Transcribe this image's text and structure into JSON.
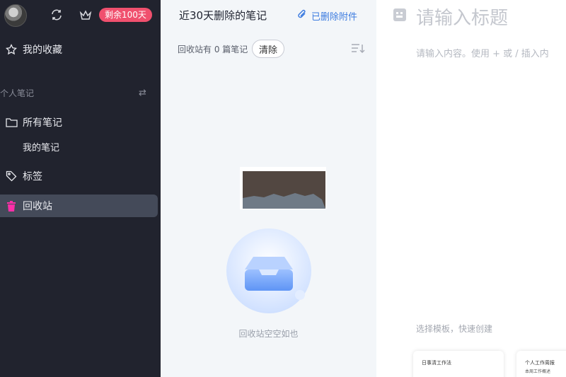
{
  "sidebar": {
    "badge": "剩余100天",
    "favorites": "我的收藏",
    "section": "个人笔记",
    "all_notes": "所有笔记",
    "my_notes": "我的笔记",
    "tags": "标签",
    "trash": "回收站"
  },
  "middle": {
    "title": "近30天删除的笔记",
    "deleted_attachments": "已删除附件",
    "count_text": "回收站有 0 篇笔记",
    "clear_button": "清除",
    "empty_text": "回收站空空如也"
  },
  "editor": {
    "title_placeholder": "请输入标题",
    "content_placeholder": "请输入内容。使用 + 或 / 插入内",
    "template_label": "选择模板，快速创建",
    "templates": [
      {
        "title": "日事清工作法",
        "subtitle": ""
      },
      {
        "title": "个人工作周报",
        "subtitle": "本周工作概述"
      }
    ]
  },
  "colors": {
    "sidebar_bg": "#21232e",
    "active_bg": "#444a59",
    "badge": "#f0506e",
    "accent_blue": "#3d7ce0",
    "trash_icon": "#ff2fa8"
  }
}
